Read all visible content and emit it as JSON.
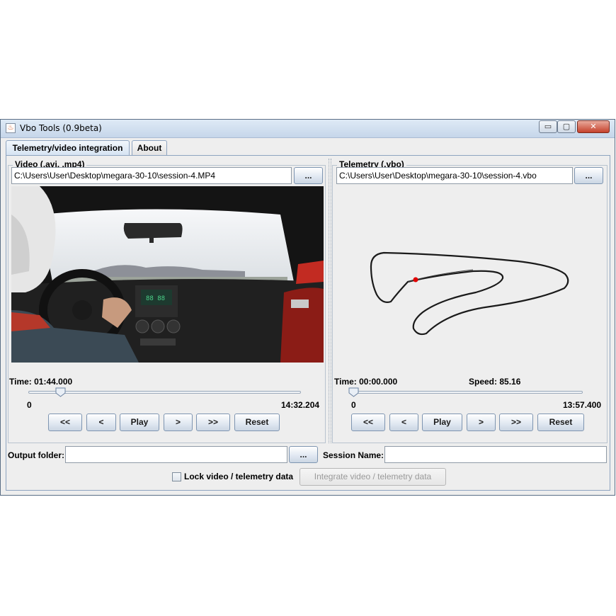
{
  "window": {
    "title": "Vbo Tools (0.9beta)",
    "controls": {
      "minimize": "▭",
      "maximize": "▢",
      "close": "✕"
    }
  },
  "tabs": [
    {
      "label": "Telemetry/video integration",
      "active": true
    },
    {
      "label": "About",
      "active": false
    }
  ],
  "video": {
    "group_title": "Video (.avi, .mp4)",
    "file_path": "C:\\Users\\User\\Desktop\\megara-30-10\\session-4.MP4",
    "browse_label": "...",
    "time_label": "Time: 01:44.000",
    "slider_min": "0",
    "slider_max": "14:32.204",
    "position_fraction": 0.119,
    "buttons": [
      "<<",
      "<",
      "Play",
      ">",
      ">>",
      "Reset"
    ]
  },
  "telemetry": {
    "group_title": "Telemetry (.vbo)",
    "file_path": "C:\\Users\\User\\Desktop\\megara-30-10\\session-4.vbo",
    "browse_label": "...",
    "time_label": "Time: 00:00.000",
    "speed_label": "Speed: 85.16",
    "slider_min": "0",
    "slider_max": "13:57.400",
    "position_fraction": 0.0,
    "buttons": [
      "<<",
      "<",
      "Play",
      ">",
      ">>",
      "Reset"
    ],
    "marker_color": "#e00000"
  },
  "output": {
    "folder_label": "Output folder:",
    "folder_value": "",
    "browse_label": "...",
    "session_label": "Session Name:",
    "session_value": "",
    "lock_label": "Lock video / telemetry data",
    "lock_checked": false,
    "integrate_label": "Integrate video / telemetry data"
  },
  "colors": {
    "window_bg": "#eeeeee",
    "title_gradient_top": "#dfeaf6",
    "close_button": "#c5412b"
  }
}
